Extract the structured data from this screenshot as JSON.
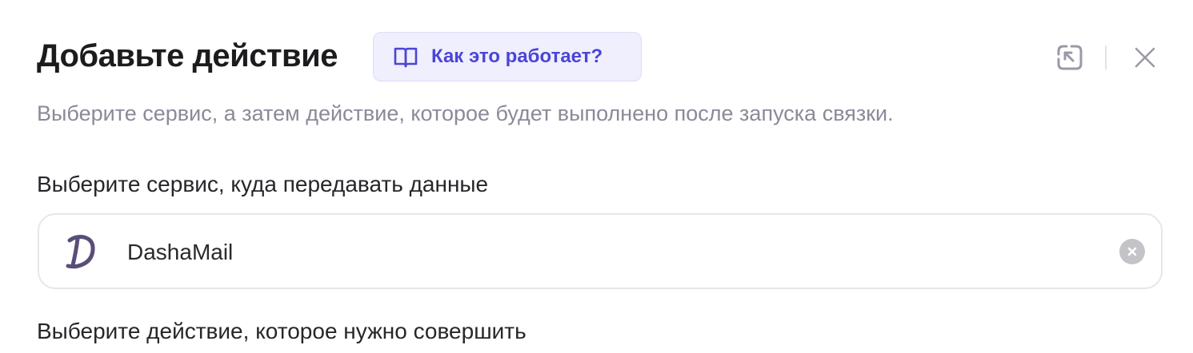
{
  "header": {
    "title": "Добавьте действие",
    "help_button_label": "Как это работает?",
    "help_icon": "book-icon",
    "collapse_icon": "collapse-arrow-icon",
    "close_icon": "close-icon"
  },
  "subtitle": "Выберите сервис, а затем действие, которое будет выполнено после запуска связки.",
  "service_field": {
    "label": "Выберите сервис, куда передавать данные",
    "value": "DashaMail",
    "logo_icon": "dashamail-logo-icon",
    "clear_icon": "clear-icon"
  },
  "action_field": {
    "label": "Выберите действие, которое нужно совершить"
  },
  "colors": {
    "accent": "#4b45d6",
    "help_bg": "#efeffd",
    "muted_text": "#8a8a99",
    "border": "#e6e6ec",
    "logo": "#5a4e78"
  }
}
